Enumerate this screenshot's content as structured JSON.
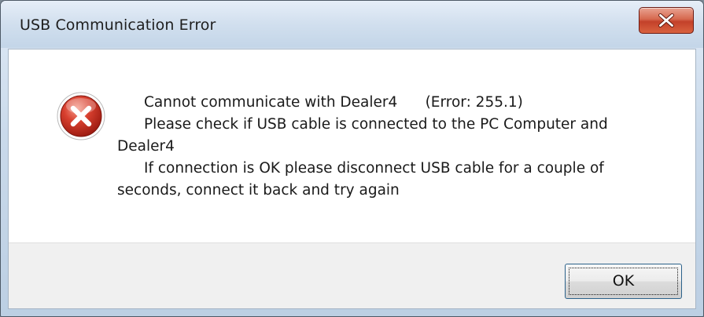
{
  "window": {
    "title": "USB Communication Error"
  },
  "titlebar": {
    "close_icon": "close-x-icon"
  },
  "message": {
    "icon": "error-icon",
    "lines": [
      "Cannot communicate with Dealer4      (Error: 255.1)",
      "Please check if USB cable is connected to the PC Computer and",
      "Dealer4",
      "If connection is OK please disconnect USB cable for a couple of",
      "seconds, connect it back and try again"
    ]
  },
  "buttons": {
    "ok_label": "OK"
  },
  "colors": {
    "close_button": "#c94a30",
    "error_red": "#c62828",
    "focus_border": "#2c628b"
  }
}
